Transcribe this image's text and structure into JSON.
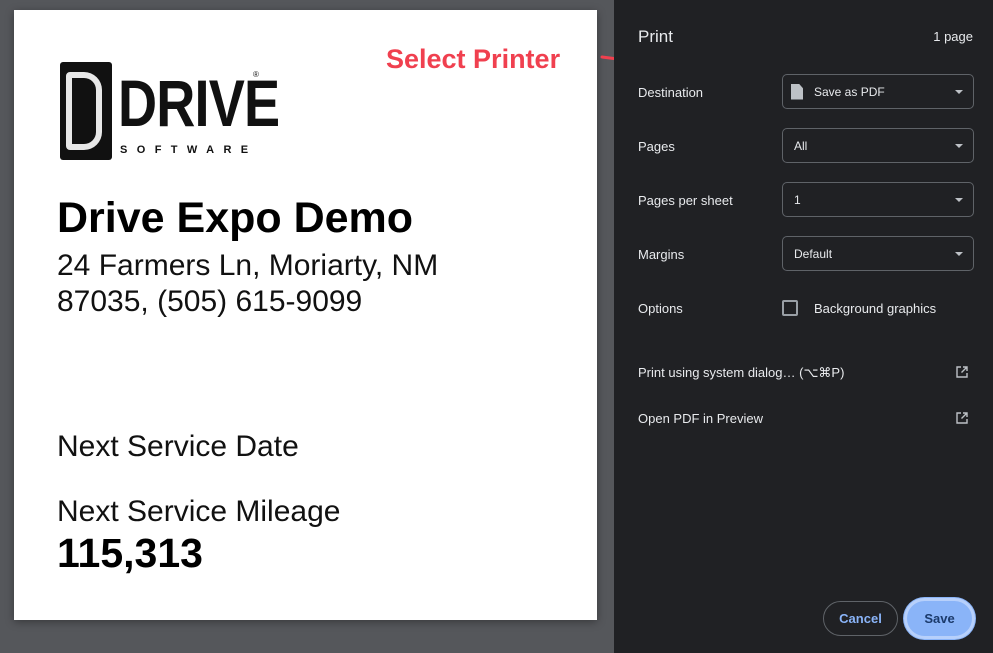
{
  "preview": {
    "logo": {
      "letter": "D",
      "word": "DRIVE",
      "reg": "®",
      "sub": "SOFTWARE"
    },
    "company_name": "Drive Expo Demo",
    "address": "24 Farmers Ln, Moriarty, NM 87035, (505) 615-9099",
    "next_service_date_label": "Next Service Date",
    "next_service_mileage_label": "Next Service Mileage",
    "next_service_mileage_value": "115,313"
  },
  "annotation": {
    "text": "Select Printer",
    "color": "#f0404f"
  },
  "print_panel": {
    "title": "Print",
    "page_count": "1 page",
    "destination": {
      "label": "Destination",
      "value": "Save as PDF",
      "icon": "document-icon"
    },
    "pages": {
      "label": "Pages",
      "value": "All"
    },
    "pages_per_sheet": {
      "label": "Pages per sheet",
      "value": "1"
    },
    "margins": {
      "label": "Margins",
      "value": "Default"
    },
    "options": {
      "label": "Options",
      "background_graphics": {
        "label": "Background graphics",
        "checked": false
      }
    },
    "system_dialog": {
      "label": "Print using system dialog… (⌥⌘P)",
      "icon": "open-external-icon"
    },
    "open_pdf_preview": {
      "label": "Open PDF in Preview",
      "icon": "open-external-icon"
    },
    "cancel_label": "Cancel",
    "save_label": "Save"
  },
  "colors": {
    "panel_bg": "#202124",
    "accent": "#8ab4f8",
    "preview_bg": "#55575b"
  }
}
